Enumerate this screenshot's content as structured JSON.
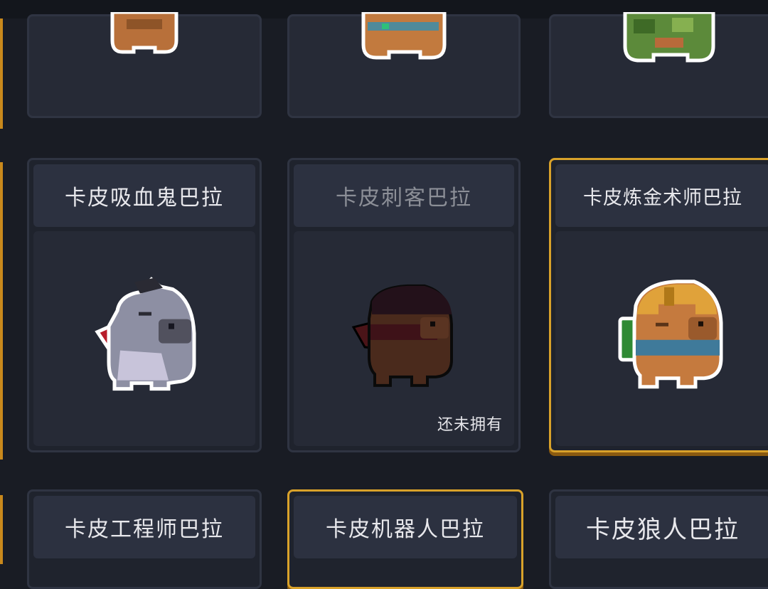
{
  "colors": {
    "background": "#191c24",
    "card_border": "#2f3442",
    "selected_border": "#d9a22a",
    "label_text": "#e8e8ec",
    "locked_label_text": "#8c8f97"
  },
  "top_row": [
    {
      "sprite": "capybara-brown-icon"
    },
    {
      "sprite": "capybara-bandana-icon"
    },
    {
      "sprite": "capybara-camo-icon"
    }
  ],
  "skins": [
    {
      "label": "卡皮吸血鬼巴拉",
      "sprite": "vampire-capybara-icon",
      "locked": false,
      "selected": false,
      "status": ""
    },
    {
      "label": "卡皮刺客巴拉",
      "sprite": "assassin-capybara-icon",
      "locked": true,
      "selected": false,
      "status": "还未拥有"
    },
    {
      "label": "卡皮炼金术师巴拉",
      "sprite": "alchemist-capybara-icon",
      "locked": false,
      "selected": true,
      "status": ""
    }
  ],
  "bottom_row": [
    {
      "label": "卡皮工程师巴拉",
      "selected": false
    },
    {
      "label": "卡皮机器人巴拉",
      "selected": true
    },
    {
      "label": "卡皮狼人巴拉",
      "selected": false
    }
  ]
}
